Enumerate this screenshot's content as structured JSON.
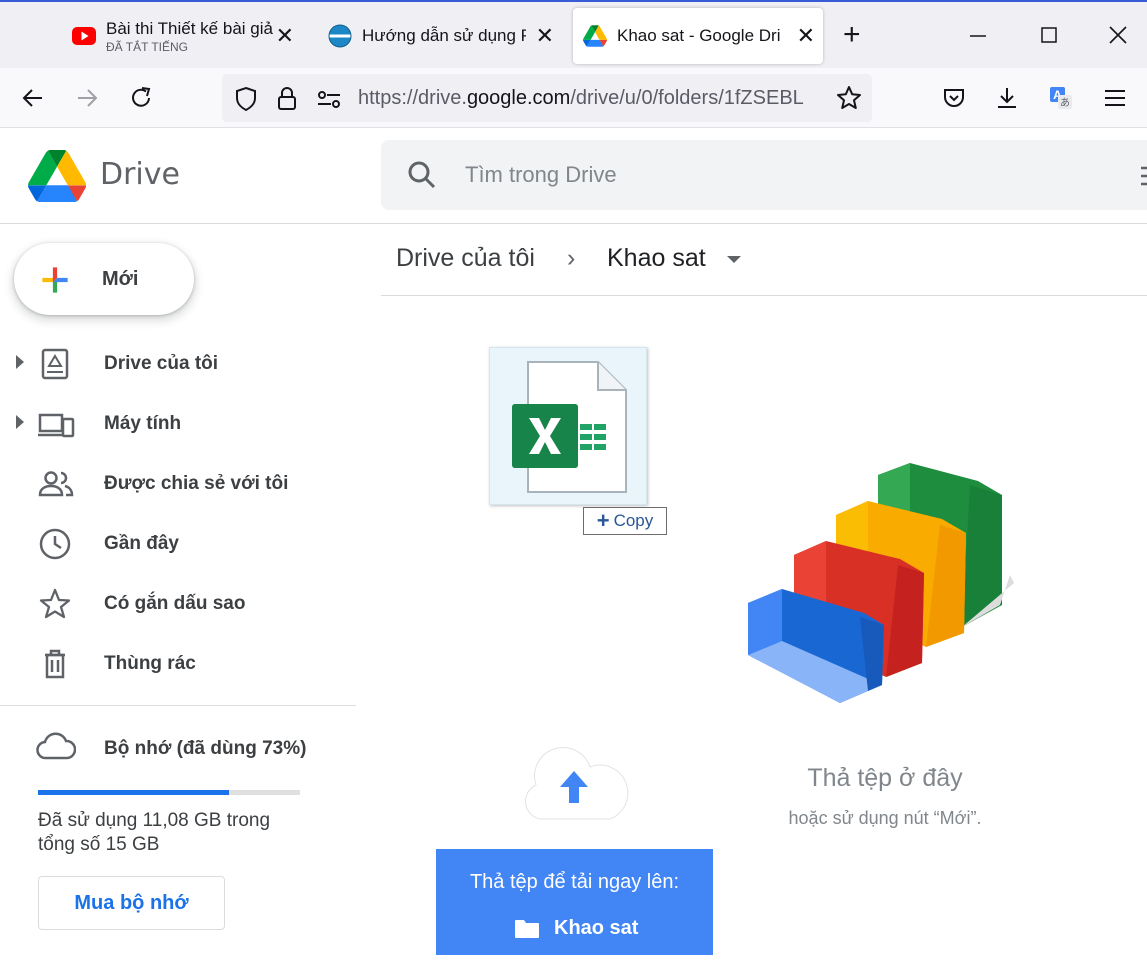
{
  "browser": {
    "tabs": [
      {
        "title": "Bài thi Thiết kế bài giả",
        "subtitle": "ĐÃ TẮT TIẾNG",
        "favicon": "youtube-icon"
      },
      {
        "title": "Hướng dẫn sử dụng P",
        "favicon": "site-icon"
      },
      {
        "title": "Khao sat - Google Dri",
        "favicon": "google-drive-icon",
        "active": true
      }
    ],
    "new_tab_label": "+",
    "url_prefix": "https://drive.",
    "url_domain": "google.com",
    "url_path": "/drive/u/0/folders/1fZSEBL"
  },
  "drive": {
    "logo_text": "Drive",
    "search_placeholder": "Tìm trong Drive",
    "new_button": "Mới",
    "nav": [
      {
        "label": "Drive của tôi",
        "icon": "my-drive-icon",
        "expandable": true
      },
      {
        "label": "Máy tính",
        "icon": "computers-icon",
        "expandable": true
      },
      {
        "label": "Được chia sẻ với tôi",
        "icon": "shared-icon"
      },
      {
        "label": "Gần đây",
        "icon": "clock-icon"
      },
      {
        "label": "Có gắn dấu sao",
        "icon": "star-icon"
      },
      {
        "label": "Thùng rác",
        "icon": "trash-icon"
      }
    ],
    "storage": {
      "label": "Bộ nhớ (đã dùng 73%)",
      "used_fraction": 0.73,
      "detail": "Đã sử dụng 11,08 GB trong tổng số 15 GB",
      "buy_button": "Mua bộ nhớ"
    },
    "breadcrumb": {
      "root": "Drive của tôi",
      "separator": "›",
      "current": "Khao sat"
    },
    "drag": {
      "tooltip_plus": "+",
      "tooltip_text": "Copy"
    },
    "empty_state": {
      "title": "Thả tệp ở đây",
      "subtitle": "hoặc sử dụng nút “Mới”."
    },
    "drop_panel": {
      "line1": "Thả tệp để tải ngay lên:",
      "folder": "Khao sat"
    }
  },
  "colors": {
    "accent": "#1a73e8",
    "drop_panel": "#4285f4",
    "excel_green": "#21a366"
  }
}
